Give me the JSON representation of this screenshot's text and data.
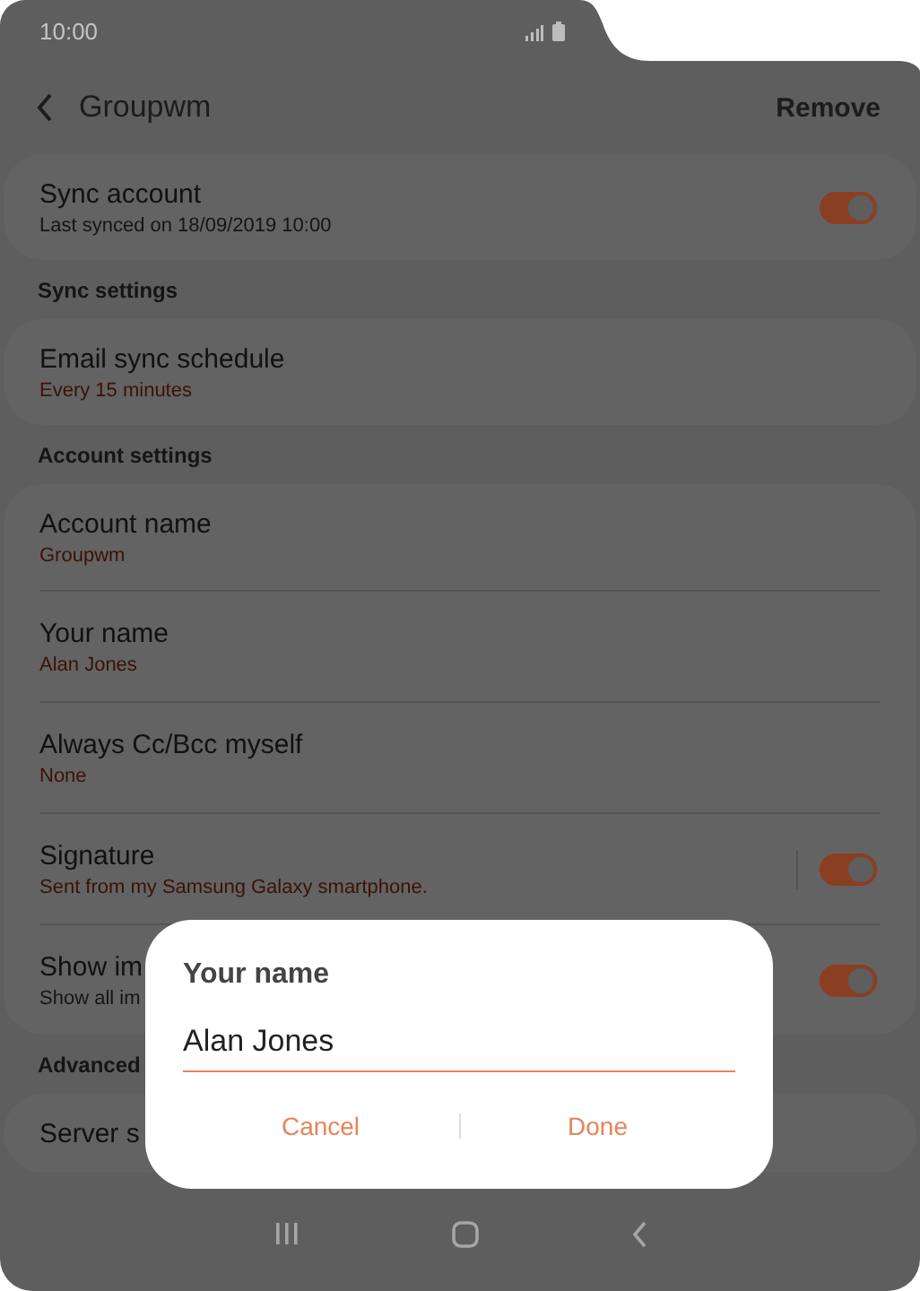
{
  "status_bar": {
    "time": "10:00"
  },
  "header": {
    "title": "Groupwm",
    "action": "Remove"
  },
  "sections": [
    {
      "items": [
        {
          "kind": "toggle",
          "title": "Sync account",
          "subtitle": "Last synced on 18/09/2019  10:00",
          "accent": false,
          "on": true
        }
      ]
    },
    {
      "header": "Sync settings",
      "items": [
        {
          "kind": "plain",
          "title": "Email sync schedule",
          "subtitle": "Every 15 minutes",
          "accent": true
        }
      ]
    },
    {
      "header": "Account settings",
      "items": [
        {
          "kind": "plain",
          "title": "Account name",
          "subtitle": "Groupwm",
          "accent": true
        },
        {
          "kind": "plain",
          "title": "Your name",
          "subtitle": "Alan Jones",
          "accent": true
        },
        {
          "kind": "plain",
          "title": "Always Cc/Bcc myself",
          "subtitle": "None",
          "accent": true
        },
        {
          "kind": "split-toggle",
          "title": "Signature",
          "subtitle": "Sent from my Samsung Galaxy smartphone.",
          "accent": true,
          "on": true
        },
        {
          "kind": "toggle",
          "title": "Show im",
          "subtitle": "Show all im",
          "accent": false,
          "on": true
        }
      ]
    },
    {
      "header": "Advanced",
      "items": [
        {
          "kind": "single",
          "title": "Server s"
        }
      ]
    }
  ],
  "dialog": {
    "title": "Your name",
    "value": "Alan Jones",
    "buttons": [
      "Cancel",
      "Done"
    ]
  }
}
